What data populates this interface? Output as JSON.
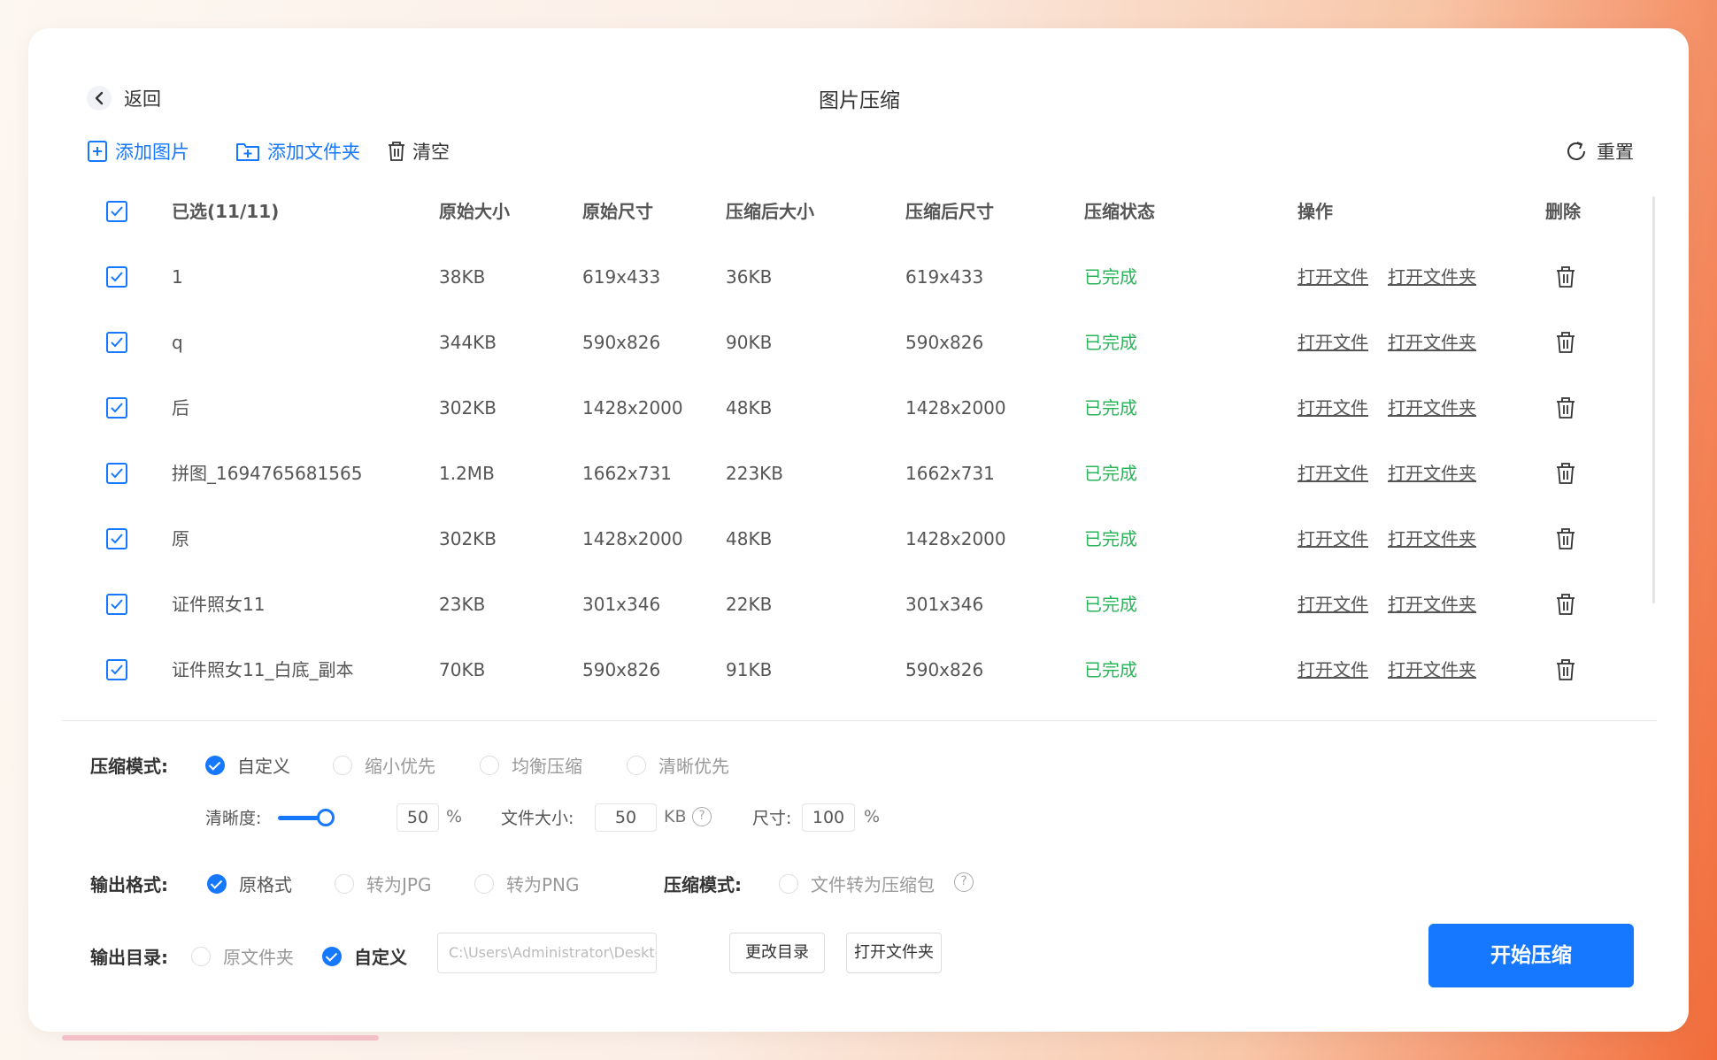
{
  "header": {
    "back_label": "返回",
    "title": "图片压缩"
  },
  "toolbar": {
    "add_image": "添加图片",
    "add_folder": "添加文件夹",
    "clear": "清空",
    "reset": "重置"
  },
  "table": {
    "headers": {
      "selected": "已选(11/11)",
      "orig_size": "原始大小",
      "orig_dim": "原始尺寸",
      "comp_size": "压缩后大小",
      "comp_dim": "压缩后尺寸",
      "status": "压缩状态",
      "actions": "操作",
      "delete": "删除"
    },
    "open_file": "打开文件",
    "open_folder": "打开文件夹",
    "rows": [
      {
        "name": "1",
        "orig_size": "38KB",
        "orig_dim": "619x433",
        "comp_size": "36KB",
        "comp_dim": "619x433",
        "status": "已完成"
      },
      {
        "name": "q",
        "orig_size": "344KB",
        "orig_dim": "590x826",
        "comp_size": "90KB",
        "comp_dim": "590x826",
        "status": "已完成"
      },
      {
        "name": "后",
        "orig_size": "302KB",
        "orig_dim": "1428x2000",
        "comp_size": "48KB",
        "comp_dim": "1428x2000",
        "status": "已完成"
      },
      {
        "name": "拼图_1694765681565",
        "orig_size": "1.2MB",
        "orig_dim": "1662x731",
        "comp_size": "223KB",
        "comp_dim": "1662x731",
        "status": "已完成"
      },
      {
        "name": "原",
        "orig_size": "302KB",
        "orig_dim": "1428x2000",
        "comp_size": "48KB",
        "comp_dim": "1428x2000",
        "status": "已完成"
      },
      {
        "name": "证件照女11",
        "orig_size": "23KB",
        "orig_dim": "301x346",
        "comp_size": "22KB",
        "comp_dim": "301x346",
        "status": "已完成"
      },
      {
        "name": "证件照女11_白底_副本",
        "orig_size": "70KB",
        "orig_dim": "590x826",
        "comp_size": "91KB",
        "comp_dim": "590x826",
        "status": "已完成"
      }
    ]
  },
  "settings": {
    "mode_label": "压缩模式:",
    "modes": [
      "自定义",
      "缩小优先",
      "均衡压缩",
      "清晰优先"
    ],
    "clarity_label": "清晰度:",
    "clarity_value": "50",
    "clarity_level": 0.5,
    "percent": "%",
    "filesize_label": "文件大小:",
    "filesize_value": "50",
    "kb": "KB",
    "dim_label": "尺寸:",
    "dim_value": "100",
    "format_label": "输出格式:",
    "formats": [
      "原格式",
      "转为JPG",
      "转为PNG"
    ],
    "pack_label": "压缩模式:",
    "pack_option": "文件转为压缩包",
    "output_label": "输出目录:",
    "output_options": [
      "原文件夹",
      "自定义"
    ],
    "output_path": "C:\\Users\\Administrator\\Desktop\\图",
    "change_dir": "更改目录",
    "open_folder": "打开文件夹",
    "start": "开始压缩"
  },
  "colors": {
    "accent": "#1677ff",
    "success": "#2bb45a"
  }
}
